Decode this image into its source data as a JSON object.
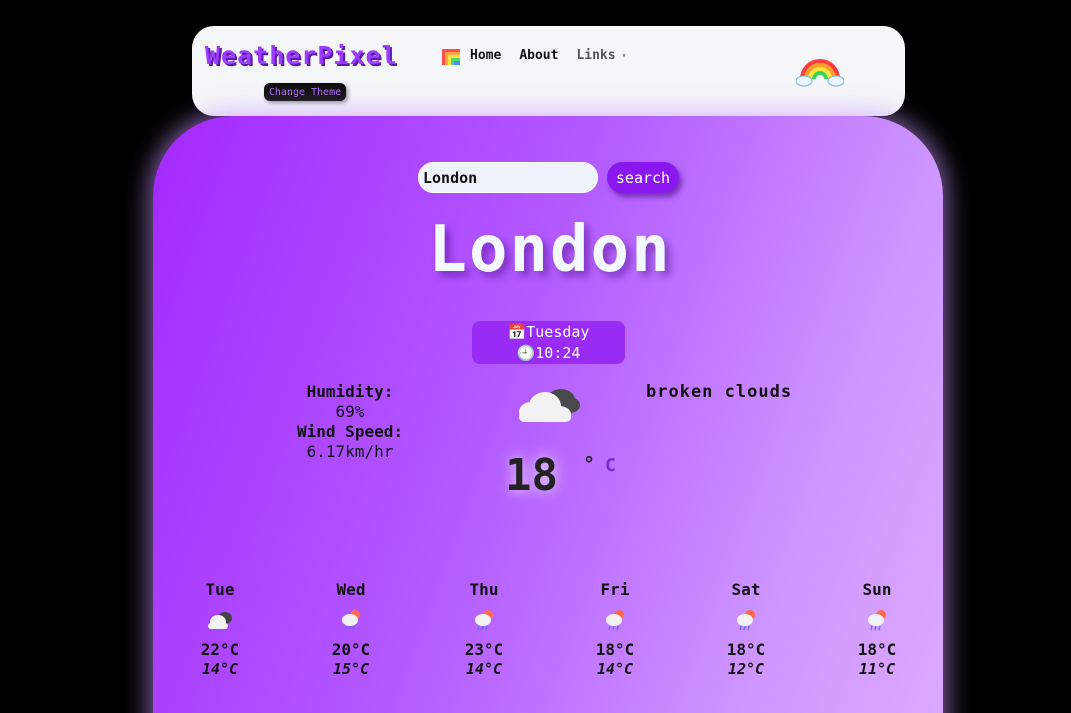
{
  "header": {
    "brand": "WeatherPixel",
    "nav": {
      "home": "Home",
      "about": "About",
      "links": "Links"
    },
    "theme_button": "Change Theme"
  },
  "search": {
    "value": "London",
    "button": "search"
  },
  "current": {
    "city": "London",
    "day": "Tuesday",
    "time": "10:24",
    "humidity_label": "Humidity:",
    "humidity_value": "69%",
    "wind_label": "Wind Speed:",
    "wind_value": "6.17km/hr",
    "description": "broken clouds",
    "temperature": "18",
    "degree": "°",
    "unit": "C",
    "icon": "broken-clouds-icon"
  },
  "forecast": [
    {
      "day": "Tue",
      "high": "22°C",
      "low": "14°C",
      "icon": "clouds-icon"
    },
    {
      "day": "Wed",
      "high": "20°C",
      "low": "15°C",
      "icon": "rain-icon"
    },
    {
      "day": "Thu",
      "high": "23°C",
      "low": "14°C",
      "icon": "rain-icon"
    },
    {
      "day": "Fri",
      "high": "18°C",
      "low": "14°C",
      "icon": "rain-icon"
    },
    {
      "day": "Sat",
      "high": "18°C",
      "low": "12°C",
      "icon": "rain-icon"
    },
    {
      "day": "Sun",
      "high": "18°C",
      "low": "11°C",
      "icon": "rain-icon"
    }
  ],
  "colors": {
    "brand": "#9b3bff",
    "card_start": "#a429ff",
    "card_end": "#dca9ff",
    "button": "#8a17f0"
  }
}
